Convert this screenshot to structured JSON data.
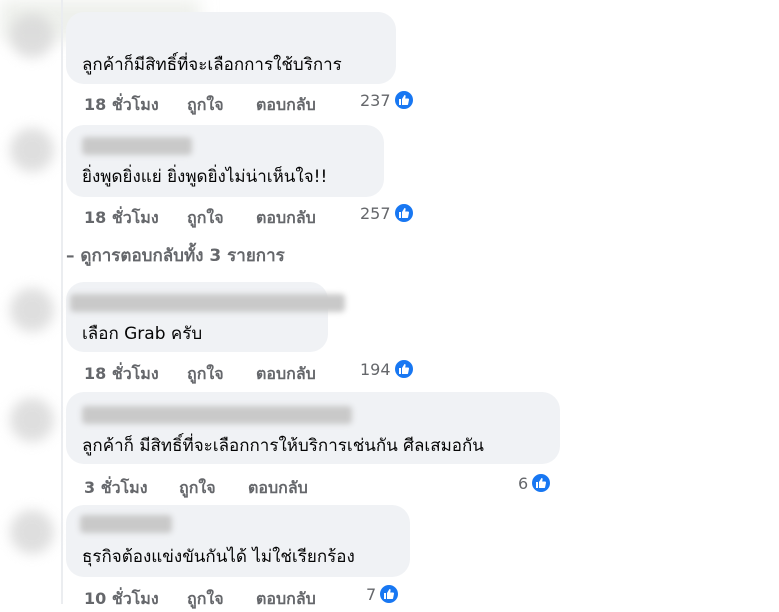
{
  "view_replies": "ดูการตอบกลับทั้ง 3 รายการ",
  "comments": [
    {
      "text": "ลูกค้าก็มีสิทธิ์ที่จะเลือกการใช้บริการ",
      "time": "18 ชั่วโมง",
      "like": "ถูกใจ",
      "reply": "ตอบกลับ",
      "reactions": "237"
    },
    {
      "text": "ยิ่งพูดยิ่งแย่ ยิ่งพูดยิ่งไม่น่าเห็นใจ!!",
      "time": "18 ชั่วโมง",
      "like": "ถูกใจ",
      "reply": "ตอบกลับ",
      "reactions": "257"
    },
    {
      "text": "เลือก Grab ครับ",
      "time": "18 ชั่วโมง",
      "like": "ถูกใจ",
      "reply": "ตอบกลับ",
      "reactions": "194"
    },
    {
      "text": "ลูกค้าก็ มีสิทธิ์ที่จะเลือกการให้บริการเช่นกัน ศีลเสมอกัน",
      "time": "3 ชั่วโมง",
      "like": "ถูกใจ",
      "reply": "ตอบกลับ",
      "reactions": "6"
    },
    {
      "text": "ธุรกิจต้องแข่งขันกันได้ ไม่ใช่เรียกร้อง",
      "time": "10 ชั่วโมง",
      "like": "ถูกใจ",
      "reply": "ตอบกลับ",
      "reactions": "7"
    }
  ],
  "colors": {
    "bubble": "#f0f2f5",
    "meta": "#65676b",
    "like_blue": "#1877f2"
  }
}
